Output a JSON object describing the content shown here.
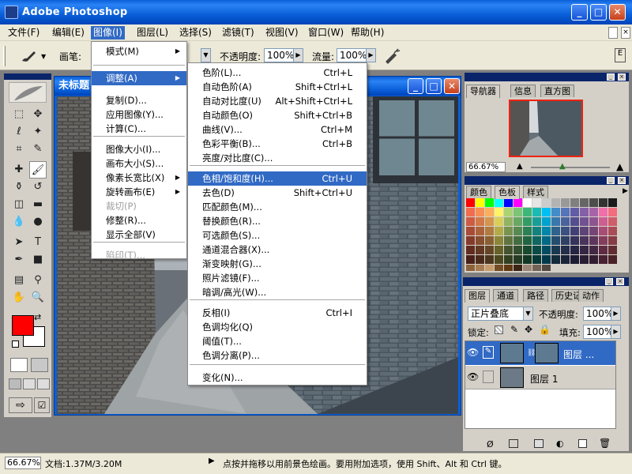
{
  "app": {
    "title": "Adobe Photoshop"
  },
  "menubar": [
    {
      "label": "文件(F)"
    },
    {
      "label": "编辑(E)"
    },
    {
      "label": "图像(I)"
    },
    {
      "label": "图层(L)"
    },
    {
      "label": "选择(S)"
    },
    {
      "label": "滤镜(T)"
    },
    {
      "label": "视图(V)"
    },
    {
      "label": "窗口(W)"
    },
    {
      "label": "帮助(H)"
    }
  ],
  "options": {
    "brush_label": "画笔:",
    "opacity_label": "不透明度:",
    "opacity_value": "100%",
    "flow_label": "流量:",
    "flow_value": "100%"
  },
  "document": {
    "title": "未标题"
  },
  "image_menu": [
    {
      "label": "模式(M)",
      "submenu": true
    },
    {
      "label": "调整(A)",
      "submenu": true,
      "highlight": true
    },
    {
      "label": "复制(D)..."
    },
    {
      "label": "应用图像(Y)..."
    },
    {
      "label": "计算(C)..."
    },
    {
      "label": "图像大小(I)..."
    },
    {
      "label": "画布大小(S)..."
    },
    {
      "label": "像素长宽比(X)",
      "submenu": true
    },
    {
      "label": "旋转画布(E)",
      "submenu": true
    },
    {
      "label": "裁切(P)",
      "disabled": true
    },
    {
      "label": "修整(R)..."
    },
    {
      "label": "显示全部(V)"
    },
    {
      "label": "陷印(T)...",
      "disabled": true
    }
  ],
  "adjust_menu": [
    {
      "label": "色阶(L)...",
      "shortcut": "Ctrl+L"
    },
    {
      "label": "自动色阶(A)",
      "shortcut": "Shift+Ctrl+L"
    },
    {
      "label": "自动对比度(U)",
      "shortcut": "Alt+Shift+Ctrl+L"
    },
    {
      "label": "自动颜色(O)",
      "shortcut": "Shift+Ctrl+B"
    },
    {
      "label": "曲线(V)...",
      "shortcut": "Ctrl+M"
    },
    {
      "label": "色彩平衡(B)...",
      "shortcut": "Ctrl+B"
    },
    {
      "label": "亮度/对比度(C)...",
      "shortcut": ""
    },
    {
      "label": "色相/饱和度(H)...",
      "shortcut": "Ctrl+U",
      "highlight": true
    },
    {
      "label": "去色(D)",
      "shortcut": "Shift+Ctrl+U"
    },
    {
      "label": "匹配颜色(M)...",
      "shortcut": ""
    },
    {
      "label": "替换颜色(R)...",
      "shortcut": ""
    },
    {
      "label": "可选颜色(S)...",
      "shortcut": ""
    },
    {
      "label": "通道混合器(X)...",
      "shortcut": ""
    },
    {
      "label": "渐变映射(G)...",
      "shortcut": ""
    },
    {
      "label": "照片滤镜(F)...",
      "shortcut": ""
    },
    {
      "label": "暗调/高光(W)...",
      "shortcut": ""
    },
    {
      "label": "反相(I)",
      "shortcut": "Ctrl+I"
    },
    {
      "label": "色调均化(Q)",
      "shortcut": ""
    },
    {
      "label": "阈值(T)...",
      "shortcut": ""
    },
    {
      "label": "色调分离(P)...",
      "shortcut": ""
    },
    {
      "label": "变化(N)...",
      "shortcut": ""
    }
  ],
  "navigator": {
    "tabs": [
      "导航器",
      "信息",
      "直方图"
    ],
    "zoom": "66.67%"
  },
  "color": {
    "tabs": [
      "颜色",
      "色板",
      "样式"
    ]
  },
  "layers": {
    "tabs": [
      "图层",
      "通道",
      "路径",
      "历史记录",
      "动作"
    ],
    "blend_mode": "正片叠底",
    "opacity_label": "不透明度:",
    "opacity_value": "100%",
    "lock_label": "锁定:",
    "fill_label": "填充:",
    "fill_value": "100%",
    "items": [
      {
        "name": "图层 ...",
        "selected": true
      },
      {
        "name": "图层 1",
        "selected": false
      }
    ]
  },
  "status": {
    "zoom": "66.67%",
    "doc": "文档:1.37M/3.20M",
    "hint": "点按并拖移以用前景色绘画。要用附加选项，使用 Shift、Alt 和 Ctrl 键。"
  },
  "colors": {
    "foreground": "#ff0000",
    "background": "#ffffff",
    "accent": "#316ac5"
  }
}
